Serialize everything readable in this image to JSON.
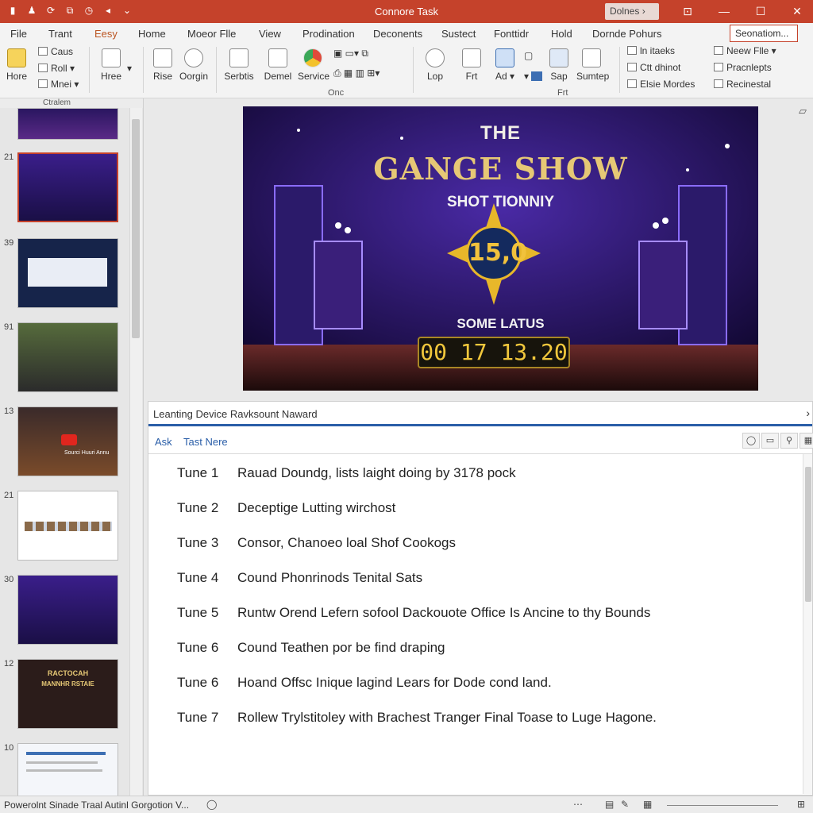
{
  "window": {
    "title": "Connore Task",
    "user_button": "Dolnes ›"
  },
  "tabs": [
    "File",
    "Trant",
    "Eesy",
    "Home",
    "Moeor Flle",
    "View",
    "Prodination",
    "Deconents",
    "Sustect",
    "Fonttidr",
    "Hold",
    "Dornde Pohurs"
  ],
  "search": {
    "value": "Seonatiom..."
  },
  "ribbon": {
    "home_label": "Hore",
    "small_group1": [
      "Caus",
      "Roll ▾",
      "Mnei ▾"
    ],
    "group1_label": "Ctralem",
    "hree_label": "Hree",
    "rise_label": "Rise",
    "origin_label": "Oorgin",
    "serbtis_label": "Serbtis",
    "demel_label": "Demel",
    "service_label": "Service",
    "group_one_label": "Onc",
    "lop_label": "Lop",
    "frt_label": "Frt",
    "ad_label": "Ad ▾",
    "sap_label": "Sap",
    "sumtep_label": "Sumtep",
    "group_frt_label": "Frt",
    "right_col1": [
      "ln itaeks",
      "Ctt dhinot",
      "Elsie Mordes"
    ],
    "right_col2": [
      "Neew Flle ▾",
      "Pracnlepts",
      "Recinestal"
    ]
  },
  "thumbnails": {
    "header": "Ctralem",
    "numbers": [
      "21",
      "39",
      "91",
      "13",
      "21",
      "30",
      "12",
      "10"
    ],
    "mini_texts": {
      "t4": "Sourci Huuri Annu",
      "t8_line1": "RACTOCAH",
      "t8_line2": "MANNHR RSTAIE"
    }
  },
  "slide": {
    "line1": "THE",
    "line2": "GANGE SHOW",
    "subtitle": "SHOT TIONNIY",
    "badge": "15,0",
    "label": "SOME LATUS",
    "timer": "00 17 13.20"
  },
  "notes": {
    "title": "Leanting Device Ravksount Naward",
    "tabs": [
      "Ask",
      "Tast Nere"
    ],
    "rows": [
      {
        "label": "Tune 1",
        "text": "Rauad Doundg, lists laight doing by 3178 pock"
      },
      {
        "label": "Tune 2",
        "text": "Deceptige Lutting wirchost"
      },
      {
        "label": "Tune 3",
        "text": "Consor, Chanoeo loal Shof Cookogs"
      },
      {
        "label": "Tune 4",
        "text": "Cound Phonrinods Tenital Sats"
      },
      {
        "label": "Tune 5",
        "text": "Runtw Orend Lefern sofool Dackouote Office Is Ancine to thy Bounds"
      },
      {
        "label": "Tune 6",
        "text": "Cound Teathen por be find draping"
      },
      {
        "label": "Tune 6",
        "text": "Hoand Offsc Inique lagind Lears for Dode cond land."
      },
      {
        "label": "Tune 7",
        "text": "Rollew Trylstitoley with Brachest Tranger Final Toase to Luge Hagone."
      }
    ]
  },
  "status": {
    "text": "Powerolnt Sinade Traal Autinl Gorgotion V..."
  },
  "colors": {
    "titlebar": "#c5422b",
    "accent": "#2a5ea8",
    "slide_bg": "#1b0f4a",
    "gold": "#e6c875"
  }
}
